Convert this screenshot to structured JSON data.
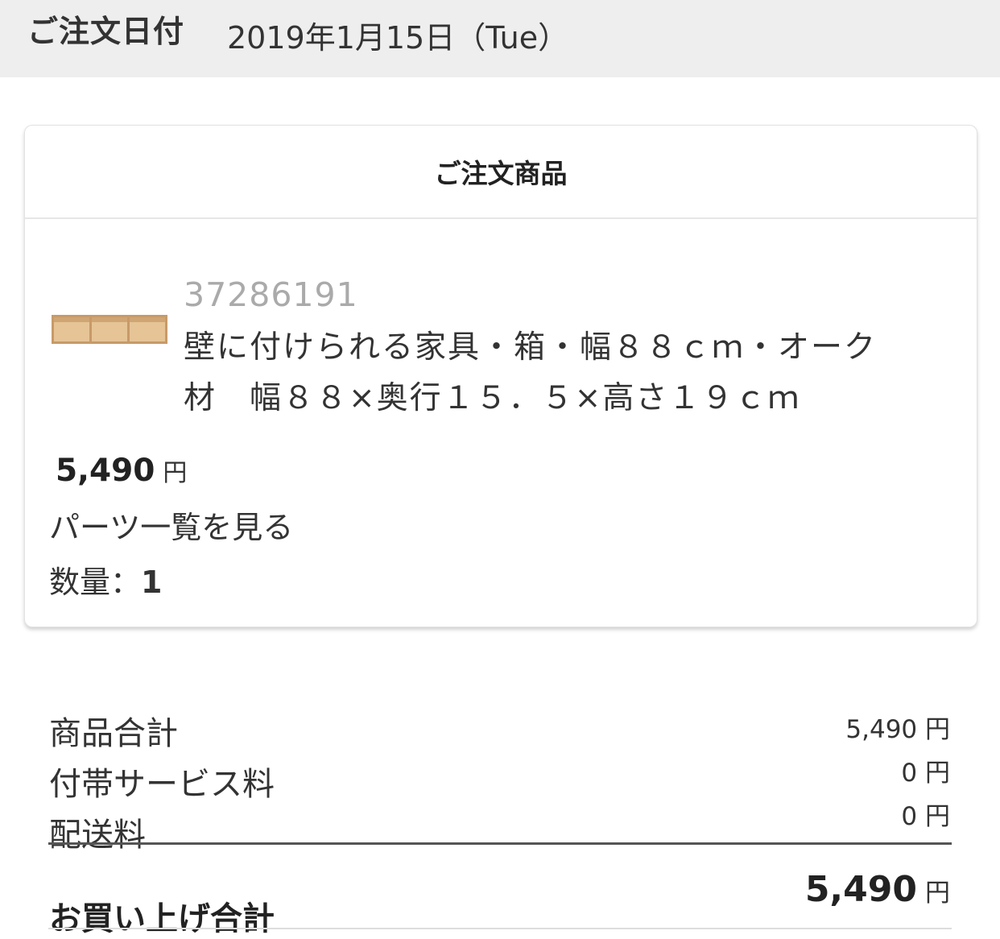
{
  "order_date": {
    "label": "ご注文日付",
    "value": "2019年1月15日（Tue）"
  },
  "order_items": {
    "title": "ご注文商品",
    "item": {
      "code": "37286191",
      "name": "壁に付けられる家具・箱・幅８８ｃｍ・オーク材　幅８８×奥行１５．５×高さ１９ｃｍ",
      "price": "5,490",
      "price_unit": "円",
      "parts_link": "パーツ一覧を見る",
      "quantity_label": "数量：",
      "quantity": "1",
      "thumbnail_icon": "oak-wall-box-shelf-image"
    }
  },
  "summary": {
    "rows": [
      {
        "label": "商品合計",
        "value": "5,490 円"
      },
      {
        "label": "付帯サービス料",
        "value": "0 円"
      },
      {
        "label": "配送料",
        "value": "0 円"
      }
    ],
    "total_label": "お買い上げ合計",
    "total_value": "5,490",
    "total_unit": "円"
  },
  "colors": {
    "header_bg": "#eeeeee",
    "text": "#333333",
    "muted": "#aaaaaa",
    "wood": "#d9ae7a"
  }
}
